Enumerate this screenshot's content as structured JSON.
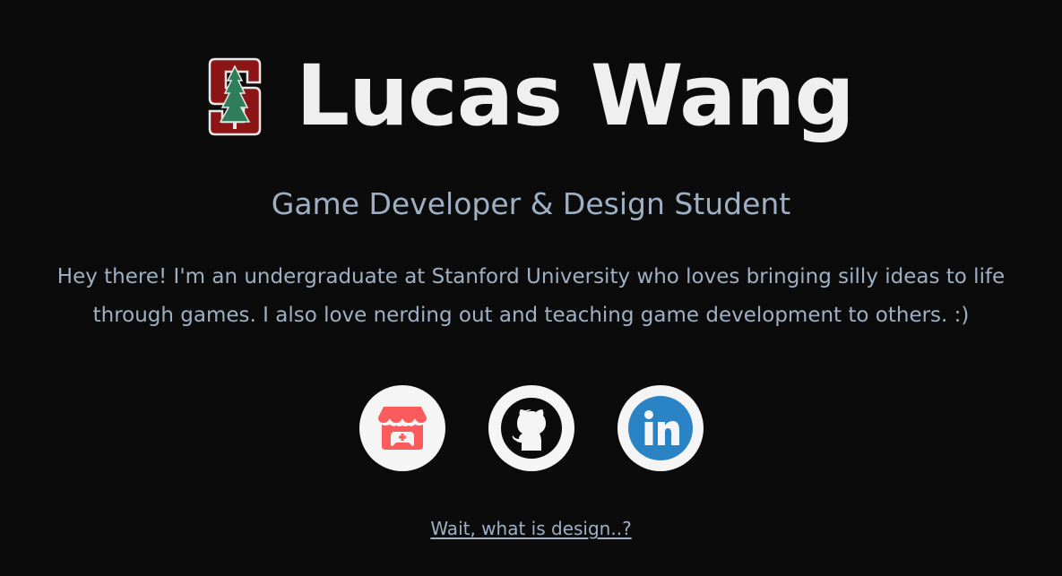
{
  "header": {
    "name": "Lucas Wang",
    "logo_icon": "stanford-s-icon"
  },
  "subtitle": "Game Developer & Design Student",
  "bio": "Hey there! I'm an undergraduate at Stanford University who loves bringing silly ideas to life through games. I also love nerding out and teaching game development to others. :)",
  "socials": [
    {
      "icon": "itchio-icon",
      "color": "#fa5c5c"
    },
    {
      "icon": "github-icon",
      "color": "#0b0b0b"
    },
    {
      "icon": "linkedin-icon",
      "color": "#2a83c4"
    }
  ],
  "design_link": "Wait, what is design..?",
  "colors": {
    "background": "#0b0b0b",
    "name": "#efefef",
    "muted_text": "#9fb0c4",
    "stanford_red": "#8c1515",
    "tree_green": "#2e7d5b"
  }
}
